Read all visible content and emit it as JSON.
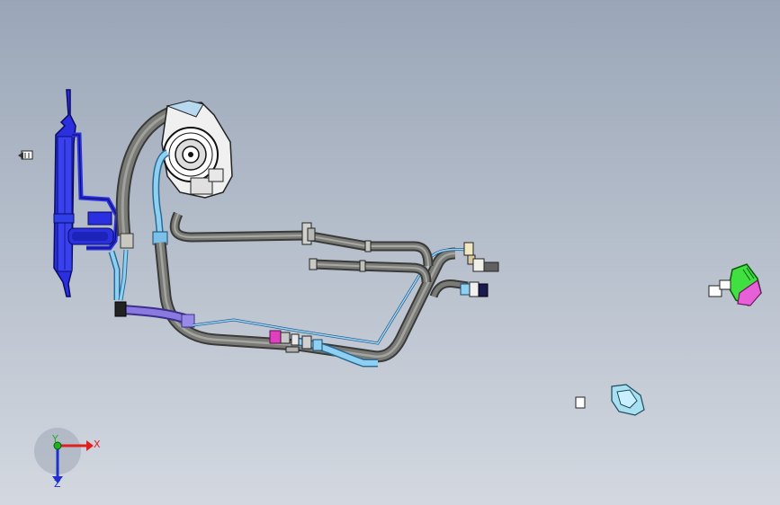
{
  "triad": {
    "x_label": "X",
    "y_label": "Y",
    "z_label": "Z",
    "x_color": "#e02020",
    "y_color": "#20b020",
    "z_color": "#2030d0"
  },
  "colors": {
    "background_top": "#9aa6b8",
    "background_bottom": "#d3d8e0",
    "pipe_gray": "#6e6e6c",
    "hose_blue": "#8fd0f0",
    "condenser_blue": "#2a2fe0",
    "hose_purple": "#7a6ad8",
    "clip_magenta": "#e040c0",
    "evap_green": "#40e040"
  }
}
